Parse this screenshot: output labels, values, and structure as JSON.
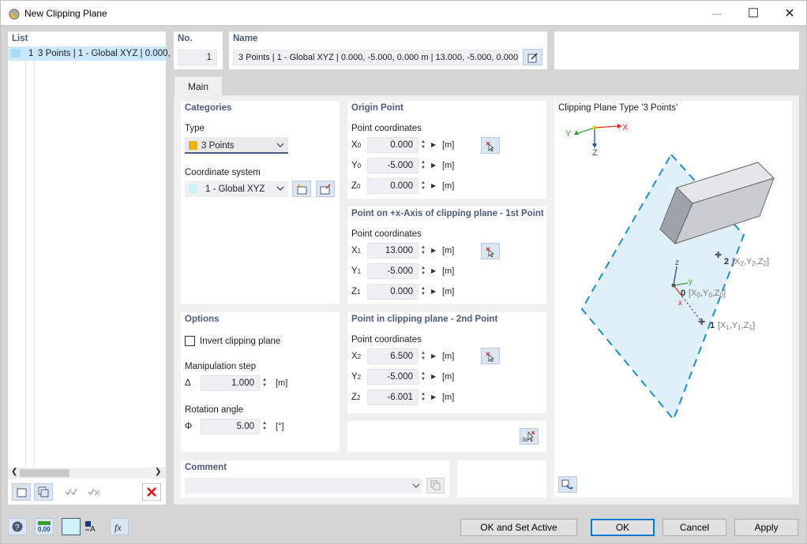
{
  "window": {
    "title": "New Clipping Plane",
    "minimize": "—",
    "maximize": "☐",
    "close": "✕"
  },
  "list": {
    "header": "List",
    "items": [
      {
        "no": "1",
        "label": "3 Points | 1 - Global XYZ | 0.000,"
      }
    ]
  },
  "no": {
    "header": "No.",
    "value": "1"
  },
  "name": {
    "header": "Name",
    "value": "3 Points | 1 - Global XYZ | 0.000, -5.000, 0.000 m | 13.000, -5.000, 0.000 m"
  },
  "tabs": [
    {
      "label": "Main"
    }
  ],
  "categories": {
    "header": "Categories",
    "type_label": "Type",
    "type_value": "3 Points",
    "type_color": "#f0b400",
    "cs_label": "Coordinate system",
    "cs_value": "1 - Global XYZ",
    "cs_color": "#cdf0f8"
  },
  "origin": {
    "header": "Origin Point",
    "sub": "Point coordinates",
    "rows": [
      {
        "axis": "X",
        "idx": "0",
        "value": "0.000",
        "unit": "[m]"
      },
      {
        "axis": "Y",
        "idx": "0",
        "value": "-5.000",
        "unit": "[m]"
      },
      {
        "axis": "Z",
        "idx": "0",
        "value": "0.000",
        "unit": "[m]"
      }
    ]
  },
  "p1": {
    "header": "Point on +x-Axis of clipping plane - 1st Point",
    "sub": "Point coordinates",
    "rows": [
      {
        "axis": "X",
        "idx": "1",
        "value": "13.000",
        "unit": "[m]"
      },
      {
        "axis": "Y",
        "idx": "1",
        "value": "-5.000",
        "unit": "[m]"
      },
      {
        "axis": "Z",
        "idx": "1",
        "value": "0.000",
        "unit": "[m]"
      }
    ]
  },
  "p2": {
    "header": "Point in clipping plane - 2nd Point",
    "sub": "Point coordinates",
    "rows": [
      {
        "axis": "X",
        "idx": "2",
        "value": "6.500",
        "unit": "[m]"
      },
      {
        "axis": "Y",
        "idx": "2",
        "value": "-5.000",
        "unit": "[m]"
      },
      {
        "axis": "Z",
        "idx": "2",
        "value": "-6.001",
        "unit": "[m]"
      }
    ]
  },
  "options": {
    "header": "Options",
    "invert_label": "Invert clipping plane",
    "invert_checked": false,
    "step_label": "Manipulation step",
    "step_symbol": "Δ",
    "step_value": "1.000",
    "step_unit": "[m]",
    "angle_label": "Rotation angle",
    "angle_symbol": "Φ",
    "angle_value": "5.00",
    "angle_unit": "[°]"
  },
  "comment": {
    "header": "Comment",
    "value": ""
  },
  "preview": {
    "title": "Clipping Plane Type '3 Points'",
    "axis_x": "X",
    "axis_y": "Y",
    "axis_z": "Z",
    "local_x": "x",
    "local_y": "y",
    "local_z": "z",
    "label0": "0",
    "label1": "1",
    "label2": "2"
  },
  "buttons": {
    "ok_active": "OK and Set Active",
    "ok": "OK",
    "cancel": "Cancel",
    "apply": "Apply"
  },
  "colors": {
    "accent": "#4a5a78",
    "plane_edge": "#1e8ccd",
    "selection": "#cce8ff"
  }
}
